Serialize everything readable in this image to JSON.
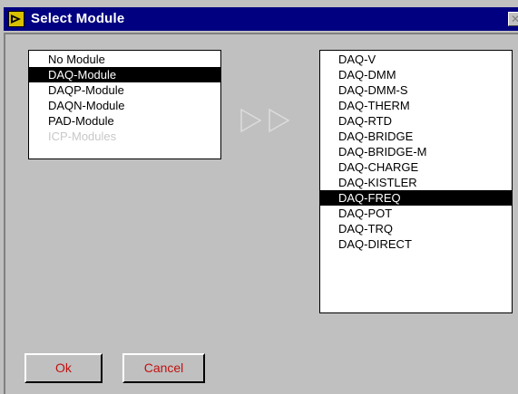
{
  "window": {
    "title": "Select Module",
    "close_symbol": "✕"
  },
  "left_list": {
    "items": [
      {
        "label": "No Module",
        "state": "normal"
      },
      {
        "label": "DAQ-Module",
        "state": "selected"
      },
      {
        "label": "DAQP-Module",
        "state": "normal"
      },
      {
        "label": "DAQN-Module",
        "state": "normal"
      },
      {
        "label": "PAD-Module",
        "state": "normal"
      },
      {
        "label": "ICP-Modules",
        "state": "disabled"
      }
    ]
  },
  "right_list": {
    "items": [
      {
        "label": "DAQ-V",
        "state": "normal"
      },
      {
        "label": "DAQ-DMM",
        "state": "normal"
      },
      {
        "label": "DAQ-DMM-S",
        "state": "normal"
      },
      {
        "label": "DAQ-THERM",
        "state": "normal"
      },
      {
        "label": "DAQ-RTD",
        "state": "normal"
      },
      {
        "label": "DAQ-BRIDGE",
        "state": "normal"
      },
      {
        "label": "DAQ-BRIDGE-M",
        "state": "normal"
      },
      {
        "label": "DAQ-CHARGE",
        "state": "normal"
      },
      {
        "label": "DAQ-KISTLER",
        "state": "normal"
      },
      {
        "label": "DAQ-FREQ",
        "state": "selected"
      },
      {
        "label": "DAQ-POT",
        "state": "normal"
      },
      {
        "label": "DAQ-TRQ",
        "state": "normal"
      },
      {
        "label": "DAQ-DIRECT",
        "state": "normal"
      }
    ]
  },
  "buttons": {
    "ok": "Ok",
    "cancel": "Cancel"
  },
  "icons": {
    "title_icon": "labview-vi-icon",
    "transfer": "double-arrow-right-icon"
  },
  "colors": {
    "titlebar": "#000080",
    "button_text": "#c01010",
    "face": "#c0c0c0"
  }
}
